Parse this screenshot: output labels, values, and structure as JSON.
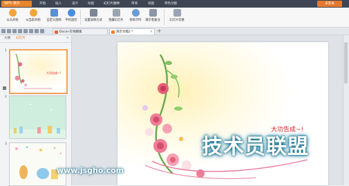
{
  "app": {
    "button_label": "WPS 演示",
    "menu": [
      "开始",
      "插入",
      "设计",
      "动画",
      "幻灯片放映",
      "审阅",
      "视图",
      "特色功能"
    ],
    "active_menu_index": 4,
    "window_button": "未登录"
  },
  "ribbon": {
    "buttons": [
      "从头开始",
      "从当前开始",
      "自定义放映",
      "手机遥控",
      "设置放映方式",
      "隐藏幻灯片",
      "排练计时",
      "演示者备注",
      "幻灯片切换"
    ]
  },
  "tabs": {
    "docs": [
      {
        "label": "Docer-在线模板"
      },
      {
        "label": "演示文稿2 *"
      }
    ],
    "add": "+"
  },
  "left_panel": {
    "tabs": [
      "大纲",
      "幻灯片"
    ],
    "active_tab": 1,
    "thumb_numbers": [
      "1",
      "2",
      "3"
    ]
  },
  "slide": {
    "title": "大功告成~!"
  },
  "watermark": {
    "main": "技术员联盟",
    "url": "www.jsgho.com"
  },
  "colors": {
    "accent": "#e8842b",
    "title_text": "#e4201c",
    "menubar": "#3f4653"
  }
}
